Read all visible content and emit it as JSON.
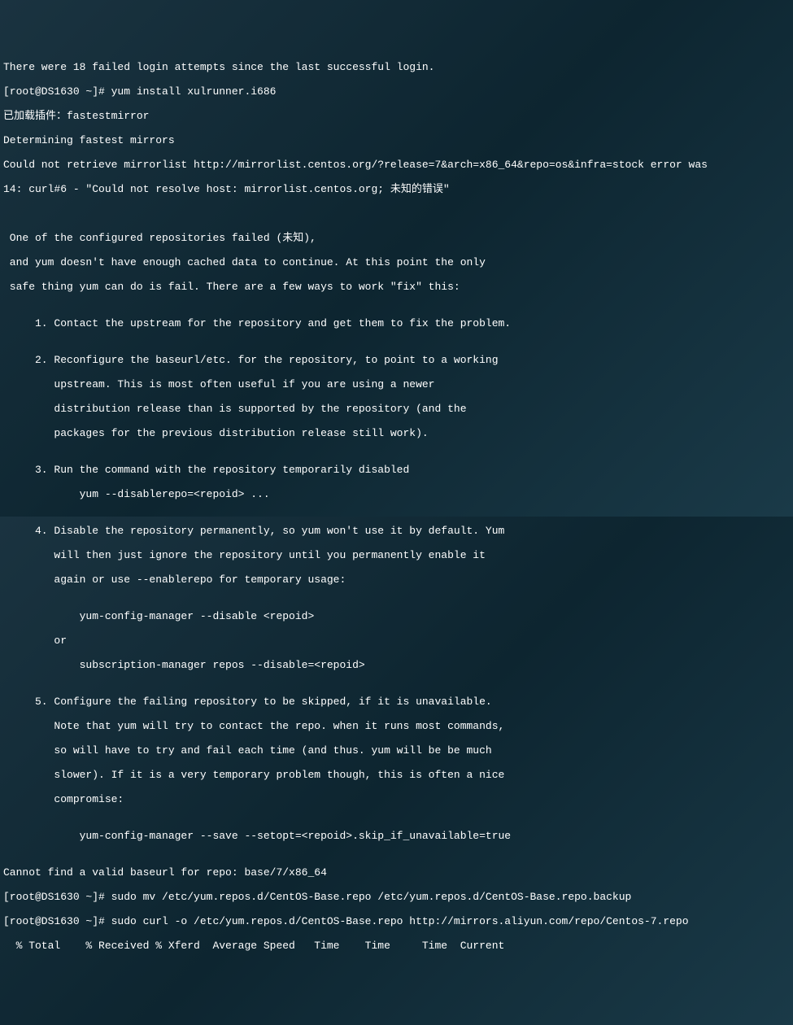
{
  "terminal": {
    "lines": [
      "There were 18 failed login attempts since the last successful login.",
      "[root@DS1630 ~]# yum install xulrunner.i686",
      "已加载插件：fastestmirror",
      "Determining fastest mirrors",
      "Could not retrieve mirrorlist http://mirrorlist.centos.org/?release=7&arch=x86_64&repo=os&infra=stock error was",
      "14: curl#6 - \"Could not resolve host: mirrorlist.centos.org; 未知的错误\"",
      "",
      "",
      " One of the configured repositories failed (未知),",
      " and yum doesn't have enough cached data to continue. At this point the only",
      " safe thing yum can do is fail. There are a few ways to work \"fix\" this:",
      "",
      "     1. Contact the upstream for the repository and get them to fix the problem.",
      "",
      "     2. Reconfigure the baseurl/etc. for the repository, to point to a working",
      "        upstream. This is most often useful if you are using a newer",
      "        distribution release than is supported by the repository (and the",
      "        packages for the previous distribution release still work).",
      "",
      "     3. Run the command with the repository temporarily disabled",
      "            yum --disablerepo=<repoid> ...",
      "",
      "     4. Disable the repository permanently, so yum won't use it by default. Yum",
      "        will then just ignore the repository until you permanently enable it",
      "        again or use --enablerepo for temporary usage:",
      "",
      "            yum-config-manager --disable <repoid>",
      "        or",
      "            subscription-manager repos --disable=<repoid>",
      "",
      "     5. Configure the failing repository to be skipped, if it is unavailable.",
      "        Note that yum will try to contact the repo. when it runs most commands,",
      "        so will have to try and fail each time (and thus. yum will be be much",
      "        slower). If it is a very temporary problem though, this is often a nice",
      "        compromise:",
      "",
      "            yum-config-manager --save --setopt=<repoid>.skip_if_unavailable=true",
      "",
      "Cannot find a valid baseurl for repo: base/7/x86_64",
      "[root@DS1630 ~]# sudo mv /etc/yum.repos.d/CentOS-Base.repo /etc/yum.repos.d/CentOS-Base.repo.backup",
      "[root@DS1630 ~]# sudo curl -o /etc/yum.repos.d/CentOS-Base.repo http://mirrors.aliyun.com/repo/Centos-7.repo",
      "  % Total    % Received % Xferd  Average Speed   Time    Time     Time  Current"
    ]
  }
}
